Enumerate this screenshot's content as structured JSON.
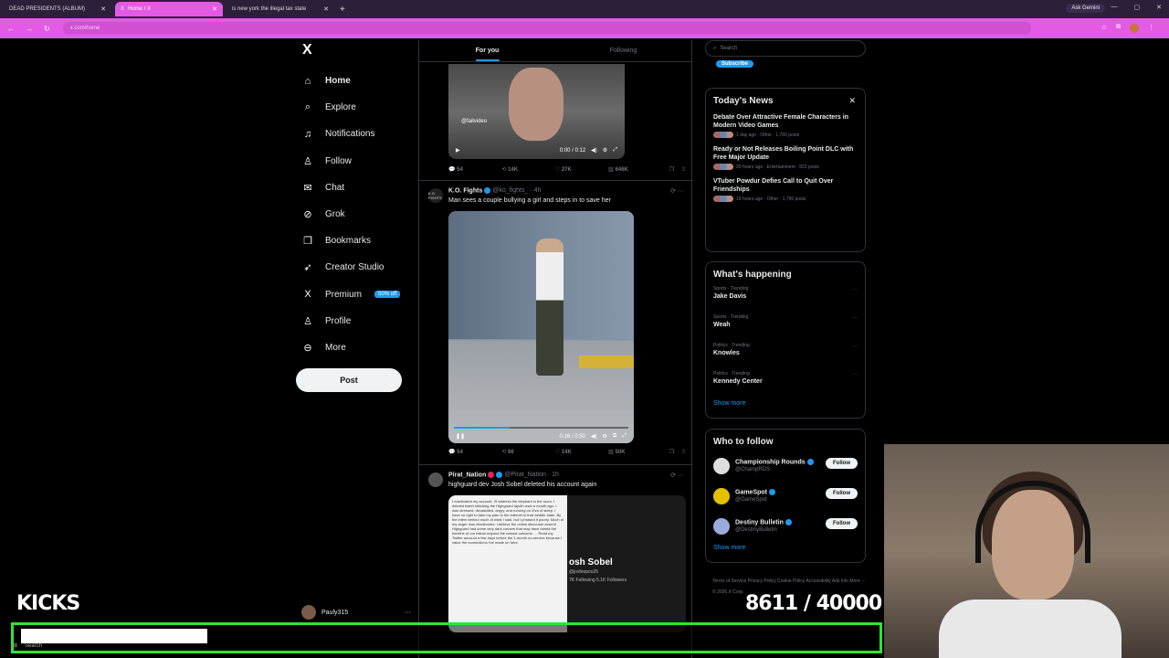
{
  "browser": {
    "tabs": [
      {
        "label": "DEAD PRESIDENTS (ALBUM)",
        "active": false
      },
      {
        "label": "Home / X",
        "active": true
      },
      {
        "label": "is new york the illegal tax state",
        "active": false
      }
    ],
    "new_tab": "+",
    "ask_gemini": "Ask Gemini",
    "url": "x.com/home",
    "accent_color": "#e45ae4"
  },
  "leftnav": {
    "logo": "X",
    "items": [
      {
        "label": "Home",
        "icon": "home-icon",
        "glyph": "⌂"
      },
      {
        "label": "Explore",
        "icon": "search-icon",
        "glyph": "⌕"
      },
      {
        "label": "Notifications",
        "icon": "bell-icon",
        "glyph": "♫"
      },
      {
        "label": "Follow",
        "icon": "person-add-icon",
        "glyph": "♙"
      },
      {
        "label": "Chat",
        "icon": "mail-icon",
        "glyph": "✉"
      },
      {
        "label": "Grok",
        "icon": "grok-icon",
        "glyph": "⊘"
      },
      {
        "label": "Bookmarks",
        "icon": "bookmark-icon",
        "glyph": "❐"
      },
      {
        "label": "Creator Studio",
        "icon": "rocket-icon",
        "glyph": "➶"
      },
      {
        "label": "Premium",
        "icon": "x-premium-icon",
        "glyph": "X",
        "badge": "50% off"
      },
      {
        "label": "Profile",
        "icon": "profile-icon",
        "glyph": "♙"
      },
      {
        "label": "More",
        "icon": "more-circle-icon",
        "glyph": "⊖"
      }
    ],
    "post_button": "Post",
    "account": {
      "name": "Pauly315",
      "menu": "···"
    }
  },
  "feed": {
    "tabs": [
      {
        "label": "For you"
      },
      {
        "label": "Following"
      }
    ],
    "post1": {
      "video_tag": "@failvideo",
      "time": "0:00 / 0:12",
      "stats": {
        "replies": "54",
        "reposts": "14K",
        "likes": "27K",
        "views": "646K"
      }
    },
    "post2": {
      "name": "K.O. Fights",
      "handle": "@ko_fights_ · 4h",
      "avatar_text": "K.O. FIGHTS",
      "text": "Man sees a couple bullying a girl and steps in to save her",
      "time": "0:16 / 0:50",
      "progress": 0.32,
      "stats": {
        "replies": "54",
        "reposts": "66",
        "likes": "14K",
        "views": "50K"
      }
    },
    "post3": {
      "name": "Pirat_Nation",
      "handle": "@Pirat_Nation · 1h",
      "text": "highguard dev Josh Sobel deleted his account again",
      "shot_profile_name": "osh Sobel",
      "shot_handle": "@joshiepoo25",
      "shot_stats": "7K Following   5.1K Followers",
      "shot_doc": "I reactivated my account, I'll address the elephant in the room. I deleted tweet following the Highguard layoff news a month ago. I was stressed, devastated, angry, and running on 2hrs of sleep. I have no right to take my pain to the internet in that volatile state. By the intent behind much of what I said, but I phrased it poorly. Much of my anger was misdirected. I believe the online discourse around Highguard had some very dark corners that may have fueled the timeline of our failure beyond the natural outcome. ... Read my Twitter account a few days before the 1-month no-service because I value the connections I've made on here."
    }
  },
  "right": {
    "search_placeholder": "Search",
    "subscribe": "Subscribe",
    "news_title": "Today's News",
    "news": [
      {
        "title": "Debate Over Attractive Female Characters in Modern Video Games",
        "meta": "1 day ago · Other · 1,760 posts"
      },
      {
        "title": "Ready or Not Releases Boiling Point DLC with Free Major Update",
        "meta": "20 hours ago · Entertainment · 822 posts"
      },
      {
        "title": "VTuber Powdur Defies Call to Quit Over Friendships",
        "meta": "19 hours ago · Other · 1,796 posts"
      }
    ],
    "happening_title": "What's happening",
    "trends": [
      {
        "context": "Sports · Trending",
        "name": "Jake Davis"
      },
      {
        "context": "Sports · Trending",
        "name": "Weah"
      },
      {
        "context": "Politics · Trending",
        "name": "Knowles"
      },
      {
        "context": "Politics · Trending",
        "name": "Kennedy Center"
      }
    ],
    "show_more": "Show more",
    "wtf_title": "Who to follow",
    "who_to_follow": [
      {
        "name": "Championship Rounds",
        "handle": "@ChampRDS",
        "follow": "Follow"
      },
      {
        "name": "GameSpot",
        "handle": "@GameSpot",
        "follow": "Follow"
      },
      {
        "name": "Destiny Bulletin",
        "handle": "@DestinyBulletin",
        "follow": "Follow"
      }
    ],
    "footer": "Terms of Service   Privacy Policy   Cookie Policy   Accessibility   Ads info   More ···   © 2026 X Corp."
  },
  "overlay": {
    "kicks_label": "KICKS",
    "counter": "8611 / 40000",
    "goal_progress": 0.215,
    "goal_color": "#2ee62e",
    "taskbar_search": "Search"
  }
}
